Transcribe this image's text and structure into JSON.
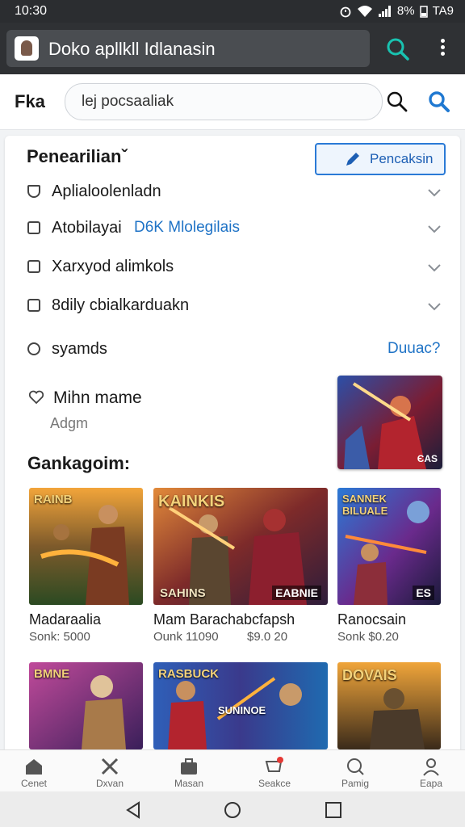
{
  "status_bar": {
    "time": "10:30",
    "right_text": "8% ",
    "clock_right": "TA9"
  },
  "browser": {
    "tab_title": "Doko apllkll Idlanasin"
  },
  "search": {
    "brand": "Fka",
    "placeholder": "lej pocsaaliak"
  },
  "filters": {
    "title": "Penearilianˇ",
    "search_button": "Pencaksin",
    "rows": [
      {
        "label": "Aplialoolenladn"
      },
      {
        "label": "Atobilayai",
        "link": "D6K Mlolegilais"
      },
      {
        "label": "Xarxyod alimkols"
      },
      {
        "label": "8dily cbialkarduakn"
      }
    ],
    "sounds": {
      "label": "syamds",
      "link": "Duuac?"
    }
  },
  "favorite": {
    "title": "Mihn mame",
    "subtitle": "Adgm"
  },
  "featured_tile_text": "ЄAS",
  "category": {
    "title": "Gankagoim:"
  },
  "games": [
    {
      "name": "Madaraalia",
      "price": "Sonk: 5000",
      "art_top": "RAINB",
      "art_bottom": ""
    },
    {
      "name": "Mam Barachabcfapsh",
      "price": "Ounk 11090",
      "price2": "$9.0 20",
      "art_top": "KAINKIS",
      "art_bottom": "SAHINS",
      "art_bottom2": "EABNIE"
    },
    {
      "name": "Ranocsain",
      "price": "Sonk $0.20",
      "art_top": "SANNEK BILUALE",
      "art_bottom": "ES"
    }
  ],
  "games_row2": [
    {
      "art_top": "BMNE"
    },
    {
      "art_top": "RASBUCK",
      "art_bottom": "SUNINOE"
    },
    {
      "art_top": "DOVAIS"
    }
  ],
  "bottom_nav": [
    {
      "label": "Cenet",
      "icon": "home-icon"
    },
    {
      "label": "Dxvan",
      "icon": "crossed-tools-icon"
    },
    {
      "label": "Masan",
      "icon": "briefcase-icon"
    },
    {
      "label": "Seakce",
      "icon": "cart-icon"
    },
    {
      "label": "Pamig",
      "icon": "search-icon"
    },
    {
      "label": "Eapa",
      "icon": "profile-icon"
    }
  ],
  "colors": {
    "accent": "#2a7ad6",
    "link": "#1f73c6",
    "teal_search": "#19c2b0"
  }
}
